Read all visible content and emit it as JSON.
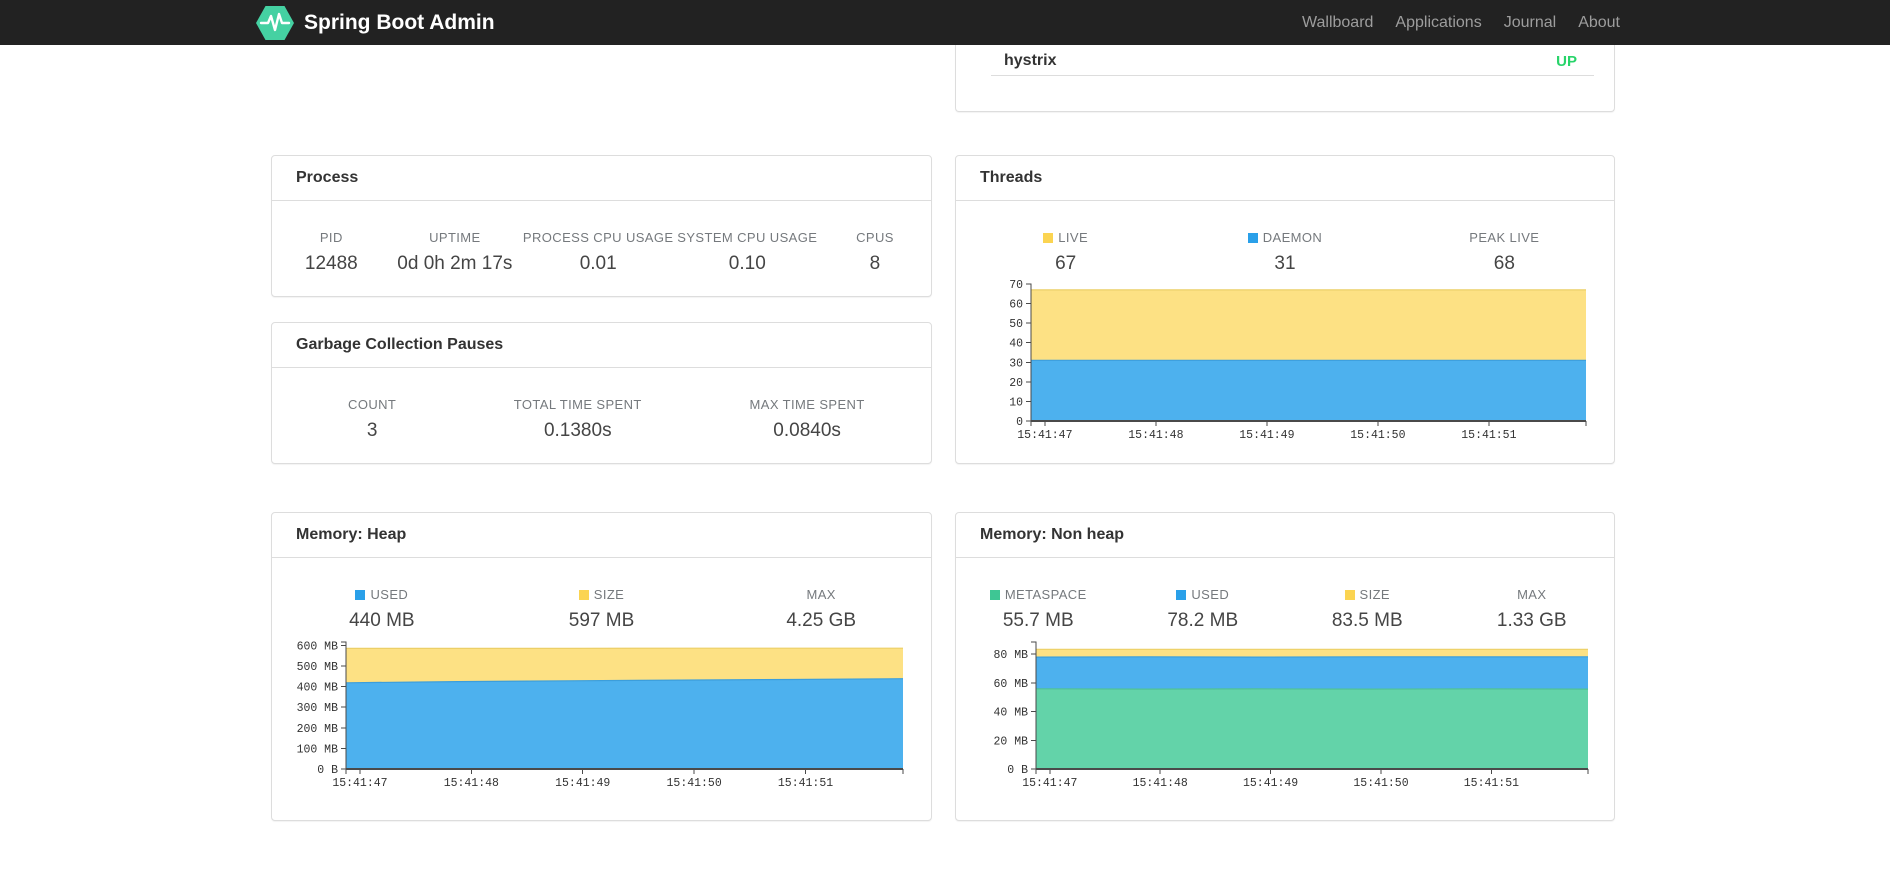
{
  "navbar": {
    "brand": "Spring Boot Admin",
    "background": "#222222",
    "logo_color": "#45d1a2",
    "items": [
      {
        "label": "Wallboard"
      },
      {
        "label": "Applications"
      },
      {
        "label": "Journal"
      },
      {
        "label": "About"
      }
    ]
  },
  "health_card": {
    "application": "hystrix",
    "status": "UP",
    "status_color": "#28d46a"
  },
  "cards": {
    "process": {
      "title": "Process",
      "metrics": [
        {
          "label": "PID",
          "value": "12488"
        },
        {
          "label": "UPTIME",
          "value": "0d 0h 2m 17s"
        },
        {
          "label": "PROCESS CPU USAGE",
          "value": "0.01"
        },
        {
          "label": "SYSTEM CPU USAGE",
          "value": "0.10"
        },
        {
          "label": "CPUS",
          "value": "8"
        }
      ]
    },
    "gc": {
      "title": "Garbage Collection Pauses",
      "metrics": [
        {
          "label": "COUNT",
          "value": "3"
        },
        {
          "label": "TOTAL TIME SPENT",
          "value": "0.1380s"
        },
        {
          "label": "MAX TIME SPENT",
          "value": "0.0840s"
        }
      ]
    },
    "threads": {
      "title": "Threads",
      "metrics": [
        {
          "label": "LIVE",
          "value": "67",
          "swatch": "#fbd451"
        },
        {
          "label": "DAEMON",
          "value": "31",
          "swatch": "#2aa0e9"
        },
        {
          "label": "PEAK LIVE",
          "value": "68"
        }
      ]
    },
    "heap": {
      "title": "Memory: Heap",
      "metrics": [
        {
          "label": "USED",
          "value": "440 MB",
          "swatch": "#2aa0e9"
        },
        {
          "label": "SIZE",
          "value": "597 MB",
          "swatch": "#fbd451"
        },
        {
          "label": "MAX",
          "value": "4.25 GB"
        }
      ]
    },
    "nonheap": {
      "title": "Memory: Non heap",
      "metrics": [
        {
          "label": "METASPACE",
          "value": "55.7 MB",
          "swatch": "#3ec694"
        },
        {
          "label": "USED",
          "value": "78.2 MB",
          "swatch": "#2aa0e9"
        },
        {
          "label": "SIZE",
          "value": "83.5 MB",
          "swatch": "#fbd451"
        },
        {
          "label": "MAX",
          "value": "1.33 GB"
        }
      ]
    }
  },
  "chart_data": [
    {
      "id": "threads",
      "type": "area",
      "title": "Threads",
      "x_tick_labels": [
        "15:41:47",
        "15:41:48",
        "15:41:49",
        "15:41:50",
        "15:41:51"
      ],
      "x_tick_fractions": [
        0.025,
        0.225,
        0.425,
        0.625,
        0.825
      ],
      "ylim": [
        0,
        70
      ],
      "draw_max": 70,
      "y_ticks": [
        {
          "value": 0,
          "label": "0"
        },
        {
          "value": 10,
          "label": "10"
        },
        {
          "value": 20,
          "label": "20"
        },
        {
          "value": 30,
          "label": "30"
        },
        {
          "value": 40,
          "label": "40"
        },
        {
          "value": 50,
          "label": "50"
        },
        {
          "value": 60,
          "label": "60"
        },
        {
          "value": 70,
          "label": "70"
        }
      ],
      "legend": [
        {
          "name": "LIVE",
          "current": "67"
        },
        {
          "name": "DAEMON",
          "current": "31"
        },
        {
          "name": "PEAK LIVE",
          "current": "68"
        }
      ],
      "series": [
        {
          "name": "LIVE",
          "fill": "#fde184",
          "stroke": "#eccf67",
          "values": [
            67,
            67,
            67,
            67,
            67,
            67
          ]
        },
        {
          "name": "DAEMON",
          "fill": "#4db1ee",
          "stroke": "#3c9edb",
          "values": [
            31,
            31,
            31,
            31,
            31,
            31
          ]
        }
      ],
      "grid": false,
      "legend_position": "top"
    },
    {
      "id": "heap",
      "type": "area",
      "title": "Memory: Heap",
      "x_tick_labels": [
        "15:41:47",
        "15:41:48",
        "15:41:49",
        "15:41:50",
        "15:41:51"
      ],
      "x_tick_fractions": [
        0.025,
        0.225,
        0.425,
        0.625,
        0.825
      ],
      "ylim": [
        0,
        616
      ],
      "draw_max": 616,
      "y_ticks": [
        {
          "value": 0,
          "label": "0 B"
        },
        {
          "value": 100,
          "label": "100 MB"
        },
        {
          "value": 200,
          "label": "200 MB"
        },
        {
          "value": 300,
          "label": "300 MB"
        },
        {
          "value": 400,
          "label": "400 MB"
        },
        {
          "value": 500,
          "label": "500 MB"
        },
        {
          "value": 600,
          "label": "600 MB"
        }
      ],
      "legend": [
        {
          "name": "USED",
          "current": "440 MB"
        },
        {
          "name": "SIZE",
          "current": "597 MB"
        },
        {
          "name": "MAX",
          "current": "4.25 GB"
        }
      ],
      "series": [
        {
          "name": "SIZE",
          "fill": "#fde184",
          "stroke": "#eccf67",
          "values": [
            585,
            585,
            585,
            586,
            586,
            586
          ]
        },
        {
          "name": "USED",
          "fill": "#4db1ee",
          "stroke": "#3c9edb",
          "values": [
            418,
            424,
            428,
            431,
            434,
            438
          ]
        }
      ],
      "grid": false,
      "legend_position": "top"
    },
    {
      "id": "nonheap",
      "type": "area",
      "title": "Memory: Non heap",
      "x_tick_labels": [
        "15:41:47",
        "15:41:48",
        "15:41:49",
        "15:41:50",
        "15:41:51"
      ],
      "x_tick_fractions": [
        0.025,
        0.225,
        0.425,
        0.625,
        0.825
      ],
      "ylim": [
        0,
        88.5
      ],
      "draw_max": 88.5,
      "y_ticks": [
        {
          "value": 0,
          "label": "0 B"
        },
        {
          "value": 20,
          "label": "20 MB"
        },
        {
          "value": 40,
          "label": "40 MB"
        },
        {
          "value": 60,
          "label": "60 MB"
        },
        {
          "value": 80,
          "label": "80 MB"
        }
      ],
      "legend": [
        {
          "name": "METASPACE",
          "current": "55.7 MB"
        },
        {
          "name": "USED",
          "current": "78.2 MB"
        },
        {
          "name": "SIZE",
          "current": "83.5 MB"
        },
        {
          "name": "MAX",
          "current": "1.33 GB"
        }
      ],
      "series": [
        {
          "name": "SIZE",
          "fill": "#fde184",
          "stroke": "#eccf67",
          "values": [
            83.4,
            83.4,
            83.4,
            83.4,
            83.4,
            83.4
          ]
        },
        {
          "name": "USED",
          "fill": "#4db1ee",
          "stroke": "#3c9edb",
          "values": [
            78.0,
            78.2,
            78.0,
            78.2,
            78.1,
            78.2
          ]
        },
        {
          "name": "METASPACE",
          "fill": "#63d3a9",
          "stroke": "#50c296",
          "values": [
            55.9,
            55.7,
            55.8,
            55.7,
            55.8,
            55.7
          ]
        }
      ],
      "grid": false,
      "legend_position": "top"
    }
  ]
}
